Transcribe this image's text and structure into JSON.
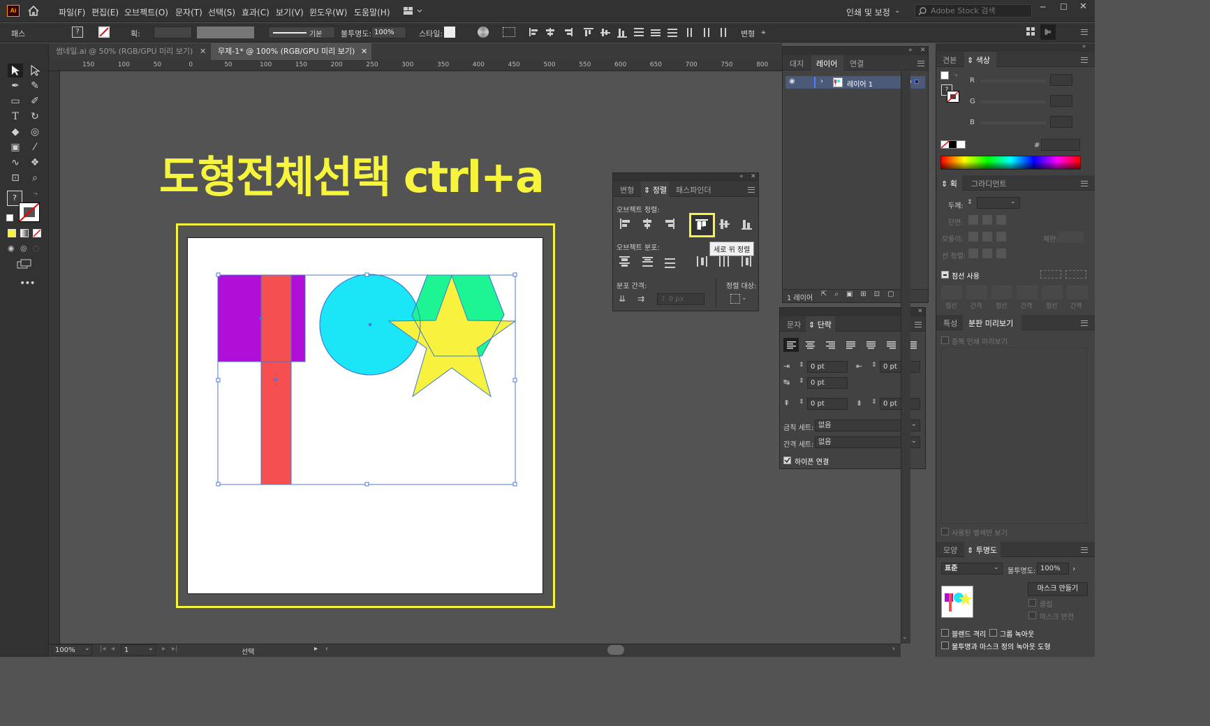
{
  "app": {
    "logo": "Ai"
  },
  "menu": [
    "파일(F)",
    "편집(E)",
    "오브젝트(O)",
    "문자(T)",
    "선택(S)",
    "효과(C)",
    "보기(V)",
    "윈도우(W)",
    "도움말(H)"
  ],
  "workspace": "인쇄 및 보정",
  "search_placeholder": "Adobe Stock 검색",
  "control": {
    "selection_label": "패스",
    "stroke_label": "획:",
    "brush_label": "기본",
    "opacity_label": "불투명도:",
    "opacity_value": "100%",
    "style_label": "스타일:",
    "transform_label": "변형"
  },
  "tabs": [
    {
      "label": "썸네일.ai @ 50% (RGB/GPU 미리 보기)"
    },
    {
      "label": "무제-1* @ 100% (RGB/GPU 미리 보기)"
    }
  ],
  "ruler_top": [
    "150",
    "100",
    "50",
    "0",
    "50",
    "100",
    "150",
    "200",
    "250",
    "300",
    "350",
    "400",
    "450",
    "500",
    "550",
    "600",
    "650",
    "700",
    "750",
    "800"
  ],
  "headline": "도형전체선택 ctrl+a",
  "shape_colors": {
    "purple": "#b10fd8",
    "red": "#f5504f",
    "cyan": "#1be6f8",
    "green": "#1df593",
    "yellow": "#f8f23e",
    "highlight": "#f7f43e"
  },
  "align_panel": {
    "tabs": [
      "변형",
      "정렬",
      "패스파인더"
    ],
    "object_align": "오브젝트 정렬:",
    "object_distribute": "오브젝트 분포:",
    "distribute_spacing": "분포 간격:",
    "align_to": "정렬 대상:",
    "spacing_value": "0 px",
    "tooltip": "세로 위 정렬"
  },
  "layers_panel": {
    "tabs": [
      "대지",
      "레이어",
      "연결"
    ],
    "layer_name": "레이어 1",
    "footer": "1 레이어"
  },
  "paragraph_panel": {
    "tabs": [
      "문자",
      "단락"
    ],
    "fields": [
      "0 pt",
      "0 pt",
      "0 pt",
      "0 pt",
      "0 pt"
    ],
    "kinsoku_label": "금칙 세트:",
    "kinsoku_value": "없음",
    "spacing_label": "간격 세트:",
    "spacing_value": "없음",
    "hyphen_label": "하이픈 연결"
  },
  "color_panel": {
    "tabs": [
      "견본",
      "색상"
    ],
    "r": "R",
    "g": "G",
    "b": "B",
    "hash": "#"
  },
  "stroke_panel": {
    "tabs": [
      "획",
      "그라디언트"
    ],
    "weight_label": "두께:",
    "cap_label": "단면:",
    "corner_label": "모퉁이:",
    "limit_label": "제한:",
    "align_label": "선 정렬:",
    "dashed_label": "점선 사용",
    "dash_labels": [
      "점선",
      "간격",
      "점선",
      "간격",
      "점선",
      "간격"
    ]
  },
  "attributes_panel": {
    "tabs": [
      "특성",
      "분판 미리보기"
    ],
    "overprint": "중복 인쇄 미리보기",
    "used_spots": "사용된 별색만 보기"
  },
  "transparency_panel": {
    "tabs": [
      "모양",
      "투명도"
    ],
    "blend_mode": "표준",
    "opacity_label": "불투명도:",
    "opacity_value": "100%",
    "make_mask": "마스크 만들기",
    "clip": "클립",
    "invert_mask": "마스크 반전",
    "isolate_blend": "블렌드 격리",
    "knockout_group": "그룹 녹아웃",
    "opacity_mask_shape": "불투명과 마스크 정의 녹아웃 도형"
  },
  "status": {
    "zoom": "100%",
    "artboard": "1",
    "tool": "선택"
  }
}
